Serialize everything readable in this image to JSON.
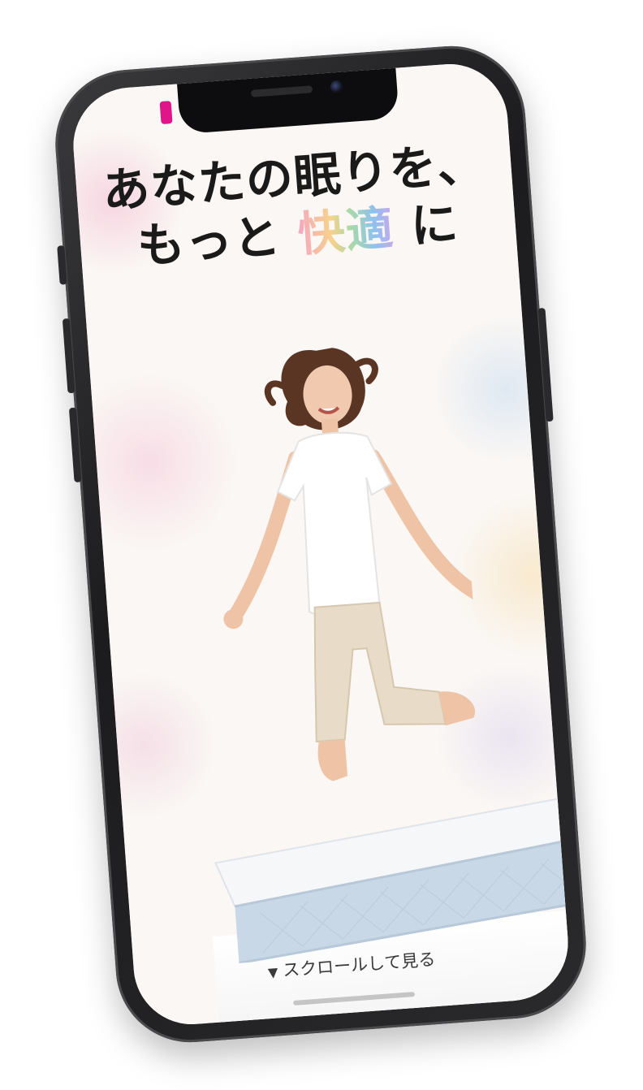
{
  "device": {
    "frame_color": "#1c1c1e",
    "accent_indicator_color": "#e0158a"
  },
  "hero": {
    "headline_line1": "あなたの眠りを、",
    "headline_line2_prefix": "もっと",
    "headline_line2_accent": "快適",
    "headline_line2_suffix": "に",
    "image_subject": "woman-jumping-on-mattress",
    "scroll_hint_arrow": "▼",
    "scroll_hint_label": "スクロールして見る"
  },
  "colors": {
    "headline_text": "#1a1a1a",
    "background": "#faf7f4",
    "mattress_side": "#c9d8e6"
  }
}
